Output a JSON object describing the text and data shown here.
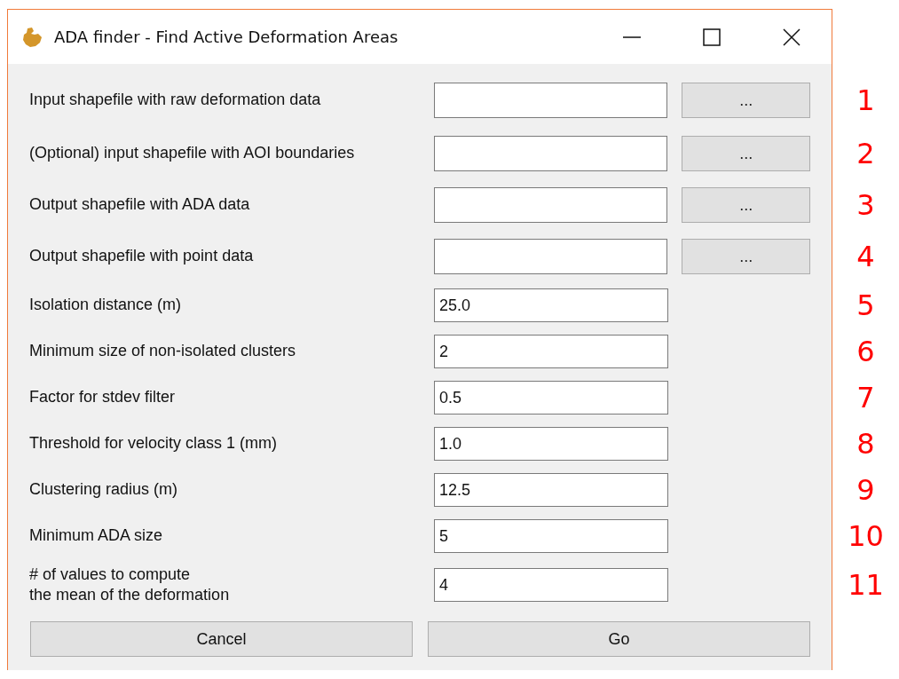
{
  "window": {
    "title": "ADA finder - Find Active Deformation Areas"
  },
  "rows": [
    {
      "kind": "file",
      "label": "Input shapefile with raw deformation data",
      "value": "",
      "button": "...",
      "marker": "1"
    },
    {
      "kind": "file",
      "label": "(Optional) input shapefile with AOI boundaries",
      "value": "",
      "button": "...",
      "marker": "2"
    },
    {
      "kind": "file",
      "label": "Output shapefile with ADA data",
      "value": "",
      "button": "...",
      "marker": "3"
    },
    {
      "kind": "file",
      "label": "Output shapefile with point data",
      "value": "",
      "button": "...",
      "marker": "4"
    },
    {
      "kind": "number",
      "label": "Isolation distance (m)",
      "value": "25.0",
      "marker": "5"
    },
    {
      "kind": "number",
      "label": "Minimum size of non-isolated clusters",
      "value": "2",
      "marker": "6"
    },
    {
      "kind": "number",
      "label": "Factor for stdev filter",
      "value": "0.5",
      "marker": "7"
    },
    {
      "kind": "number",
      "label": "Threshold for velocity class 1 (mm)",
      "value": "1.0",
      "marker": "8"
    },
    {
      "kind": "number",
      "label": "Clustering radius (m)",
      "value": "12.5",
      "marker": "9"
    },
    {
      "kind": "number",
      "label": "Minimum ADA size",
      "value": "5",
      "marker": "10"
    },
    {
      "kind": "number",
      "label": "# of values to compute\nthe mean of the deformation",
      "value": "4",
      "marker": "11"
    }
  ],
  "buttons": [
    "Cancel",
    "Go"
  ]
}
